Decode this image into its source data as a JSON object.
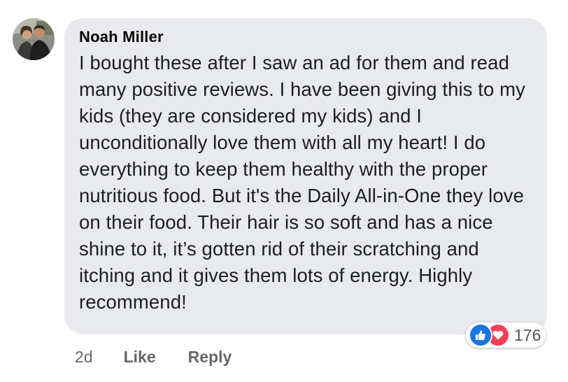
{
  "comment": {
    "author": "Noah Miller",
    "text": "I bought these after I saw an ad for them and read many positive reviews. I have been giving this to my kids (they are considered my kids) and I unconditionally love them with all my heart! I do everything to keep them healthy with the proper nutritious food. But it's the Daily All-in-One they love on their food. Their hair is so soft and has a nice shine to it, it’s gotten rid of their scratching and itching and it gives them lots of energy. Highly recommend!",
    "reactions": {
      "icons": [
        "like-icon",
        "love-icon"
      ],
      "count": "176",
      "like_color": "#1b74e4",
      "love_color": "#f33e58"
    }
  },
  "actions": {
    "timestamp": "2d",
    "like_label": "Like",
    "reply_label": "Reply"
  },
  "colors": {
    "bubble": "#e9eaed",
    "author": "#050505",
    "text": "#1c1e21",
    "meta": "#65676b"
  }
}
